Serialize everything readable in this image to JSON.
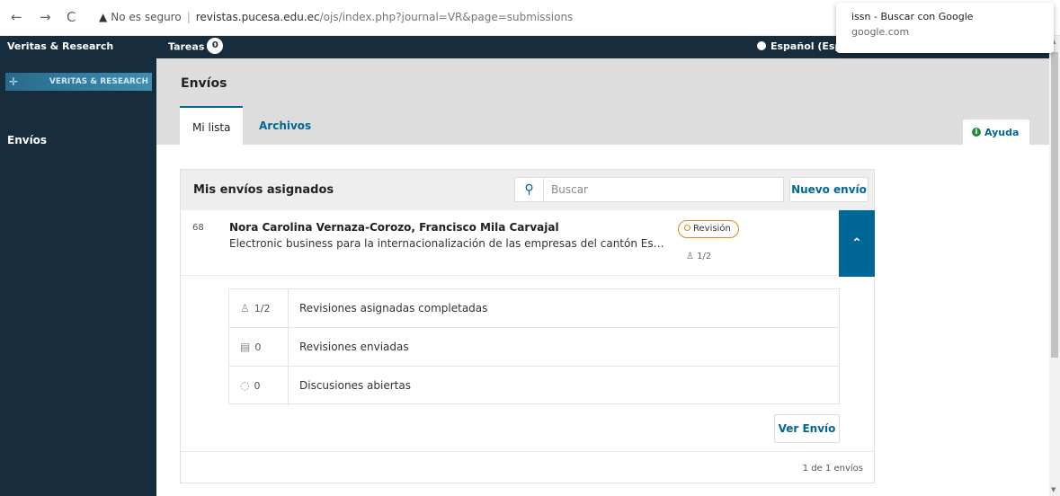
{
  "browser": {
    "back": "←",
    "forward": "→",
    "reload": "C",
    "security_label": "No es seguro",
    "url_host": "revistas.pucesa.edu.ec",
    "url_path": "/ojs/index.php?journal=VR&page=submissions",
    "menu": "⋮",
    "suggestion_title": "issn - Buscar con Google",
    "suggestion_url": "google.com"
  },
  "topbar": {
    "site_name": "Veritas & Research",
    "tasks_label": "Tareas",
    "tasks_count": "0",
    "language": "Español (Esp"
  },
  "sidebar": {
    "logo_text": "VERITAS & RESEARCH",
    "items": [
      {
        "label": "Envíos"
      }
    ]
  },
  "header": {
    "title": "Envíos",
    "tabs": [
      {
        "label": "Mi lista"
      },
      {
        "label": "Archivos"
      }
    ],
    "help_label": "Ayuda"
  },
  "panel": {
    "title": "Mis envíos asignados",
    "search_placeholder": "Buscar",
    "new_button": "Nuevo envío",
    "submission": {
      "id": "68",
      "authors": "Nora Carolina Vernaza-Corozo, Francisco Mila Carvajal",
      "title": "Electronic business para la internacionalización de las empresas del cantón Esmer...",
      "stage": "Revisión",
      "reviews": "1/2"
    },
    "details": [
      {
        "value": "1/2",
        "label": "Revisiones asignadas completadas",
        "icon": "user-icon"
      },
      {
        "value": "0",
        "label": "Revisiones enviadas",
        "icon": "file-icon"
      },
      {
        "value": "0",
        "label": "Discusiones abiertas",
        "icon": "comment-icon"
      }
    ],
    "view_button": "Ver Envío",
    "count_text": "1 de 1 envíos"
  },
  "colors": {
    "nav_dark": "#172c3c",
    "accent": "#006798",
    "stage_orange": "#e08914"
  }
}
